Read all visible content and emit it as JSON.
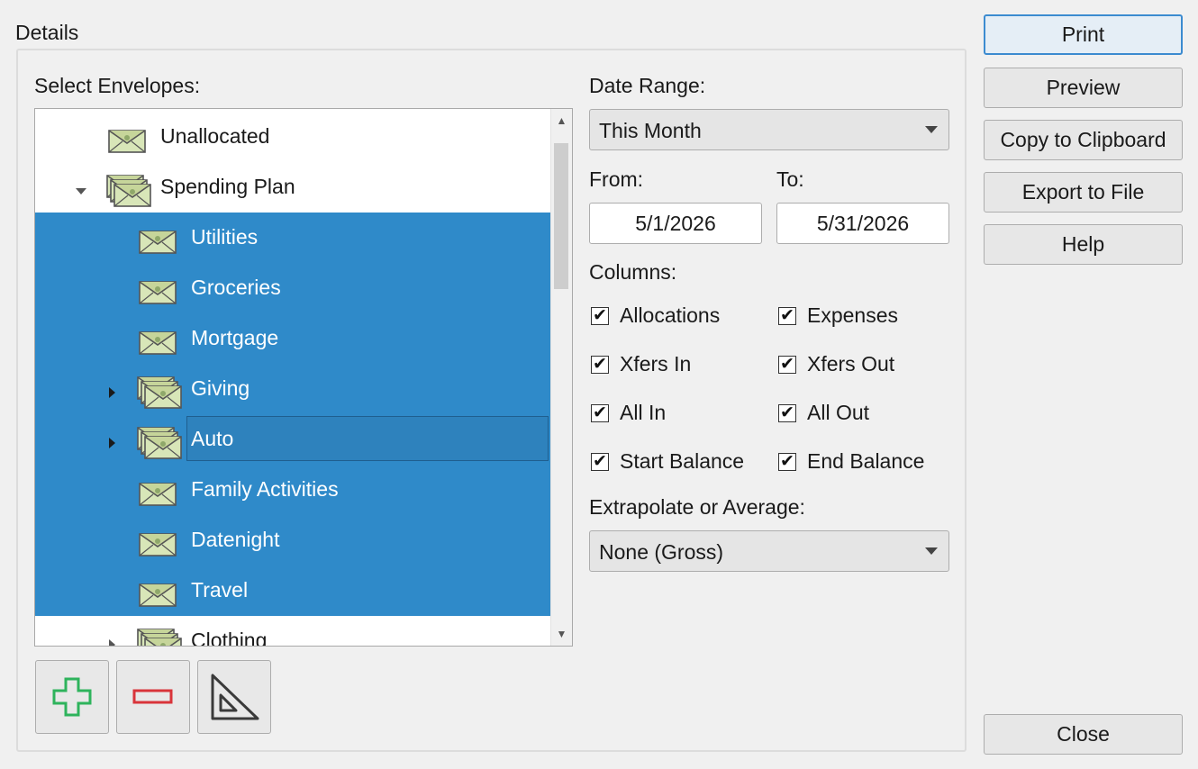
{
  "group": {
    "title": "Details"
  },
  "envelopes": {
    "label": "Select Envelopes:",
    "items": [
      {
        "label": "Unallocated",
        "icon": "envelope-icon",
        "level": 0,
        "selected": false
      },
      {
        "label": "Spending Plan",
        "icon": "envelope-stack-icon",
        "level": 0,
        "expanded": true,
        "selected": false
      },
      {
        "label": "Utilities",
        "icon": "envelope-icon",
        "level": 1,
        "selected": true
      },
      {
        "label": "Groceries",
        "icon": "envelope-icon",
        "level": 1,
        "selected": true
      },
      {
        "label": "Mortgage",
        "icon": "envelope-icon",
        "level": 1,
        "selected": true
      },
      {
        "label": "Giving",
        "icon": "envelope-stack-icon",
        "level": 1,
        "collapsed": true,
        "selected": true
      },
      {
        "label": "Auto",
        "icon": "envelope-stack-icon",
        "level": 1,
        "collapsed": true,
        "selected": true,
        "focused": true
      },
      {
        "label": "Family Activities",
        "icon": "envelope-icon",
        "level": 1,
        "selected": true
      },
      {
        "label": "Datenight",
        "icon": "envelope-icon",
        "level": 1,
        "selected": true
      },
      {
        "label": "Travel",
        "icon": "envelope-icon",
        "level": 1,
        "selected": true
      },
      {
        "label": "Clothing",
        "icon": "envelope-stack-icon",
        "level": 1,
        "collapsed": true,
        "selected": false
      }
    ]
  },
  "toolbar": {
    "add_icon": "plus-icon",
    "remove_icon": "minus-icon",
    "triangle_icon": "set-square-icon"
  },
  "date_range": {
    "label": "Date Range:",
    "value": "This Month"
  },
  "from": {
    "label": "From:",
    "value": "5/1/2026"
  },
  "to": {
    "label": "To:",
    "value": "5/31/2026"
  },
  "columns": {
    "label": "Columns:",
    "items": [
      {
        "label": "Allocations",
        "checked": true
      },
      {
        "label": "Expenses",
        "checked": true
      },
      {
        "label": "Xfers In",
        "checked": true
      },
      {
        "label": "Xfers Out",
        "checked": true
      },
      {
        "label": "All In",
        "checked": true
      },
      {
        "label": "All Out",
        "checked": true
      },
      {
        "label": "Start Balance",
        "checked": true
      },
      {
        "label": "End Balance",
        "checked": true
      }
    ],
    "check_mark": "✔"
  },
  "extrapolate": {
    "label": "Extrapolate or Average:",
    "value": "None (Gross)"
  },
  "buttons": {
    "print": "Print",
    "preview": "Preview",
    "copy": "Copy to Clipboard",
    "export": "Export to File",
    "help": "Help",
    "close": "Close"
  },
  "colors": {
    "selection": "#2f8ac9",
    "plus": "#2eb35c",
    "minus": "#d9343a"
  }
}
